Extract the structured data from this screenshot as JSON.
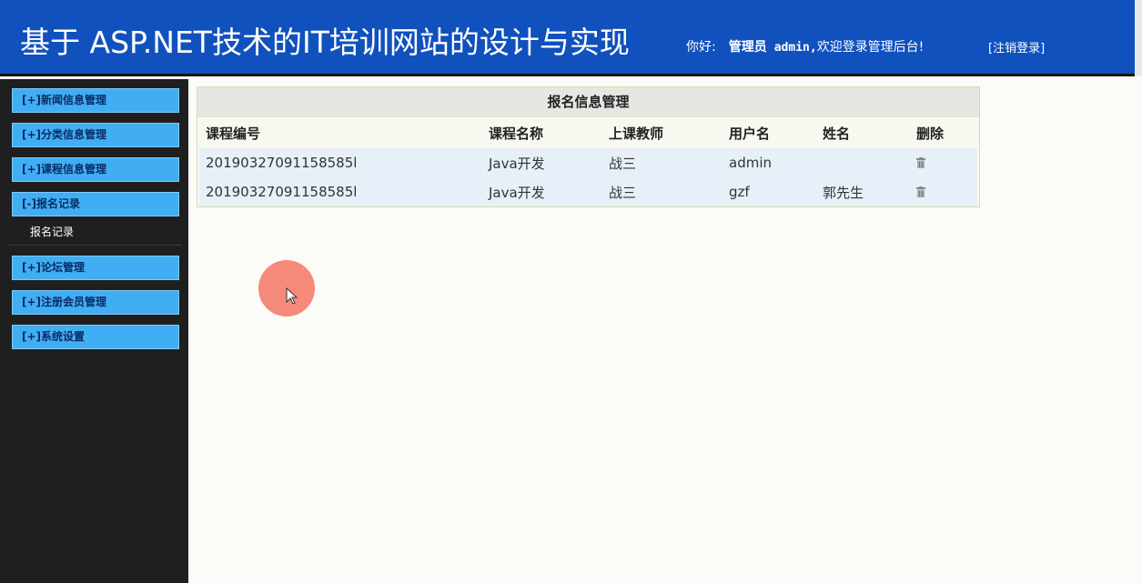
{
  "header": {
    "title": "基于 ASP.NET技术的IT培训网站的设计与实现",
    "greeting": "你好:",
    "role": "管理员",
    "username": "admin,",
    "welcome": "欢迎登录管理后台!",
    "logout": "[注销登录]"
  },
  "sidebar": {
    "items": [
      {
        "label": "[+]新闻信息管理"
      },
      {
        "label": "[+]分类信息管理"
      },
      {
        "label": "[+]课程信息管理"
      },
      {
        "label": "[-]报名记录"
      },
      {
        "label": "[+]论坛管理"
      },
      {
        "label": "[+]注册会员管理"
      },
      {
        "label": "[+]系统设置"
      }
    ],
    "sub_item": "报名记录"
  },
  "panel": {
    "title": "报名信息管理",
    "columns": [
      "课程编号",
      "课程名称",
      "上课教师",
      "用户名",
      "姓名",
      "删除"
    ],
    "rows": [
      {
        "course_no": "20190327091158585l",
        "course_name": "Java开发",
        "teacher": "战三",
        "user": "admin",
        "name": ""
      },
      {
        "course_no": "20190327091158585l",
        "course_name": "Java开发",
        "teacher": "战三",
        "user": "gzf",
        "name": "郭先生"
      }
    ]
  },
  "icons": {
    "delete": "trash-icon",
    "cursor": "pointer-cursor-icon"
  },
  "colors": {
    "header": "#1151bd",
    "sidebar": "#1f1f1f",
    "menu_button": "#41aef3"
  }
}
